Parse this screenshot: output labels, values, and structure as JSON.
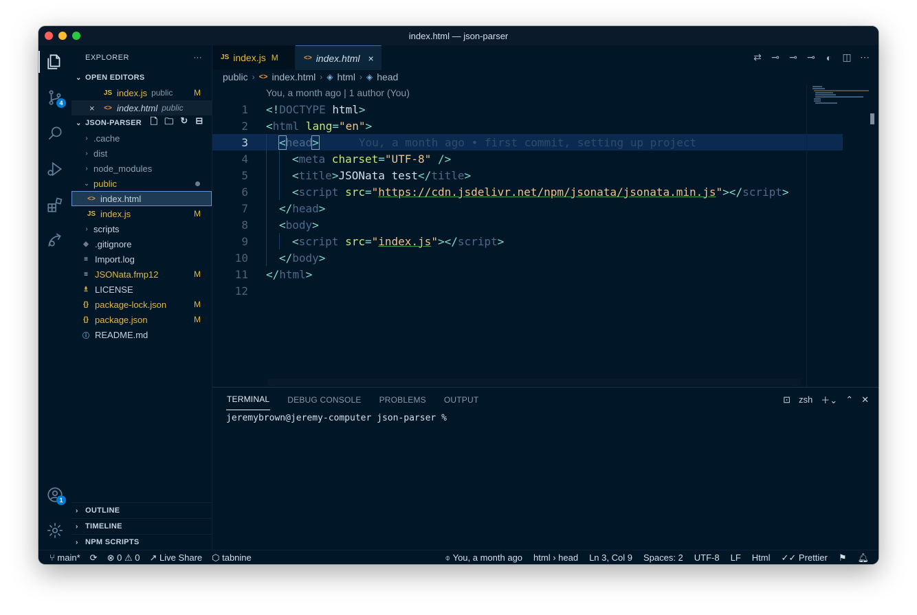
{
  "window": {
    "title": "index.html — json-parser"
  },
  "activity_bar": {
    "items": [
      {
        "icon": "files-icon",
        "active": true
      },
      {
        "icon": "source-control-icon",
        "badge": "4"
      },
      {
        "icon": "search-icon"
      },
      {
        "icon": "run-debug-icon"
      },
      {
        "icon": "extensions-icon"
      },
      {
        "icon": "remote-explorer-icon"
      }
    ],
    "bottom": [
      {
        "icon": "account-icon",
        "badge": "1"
      },
      {
        "icon": "settings-gear-icon"
      }
    ]
  },
  "sidebar": {
    "title": "EXPLORER",
    "more": "···",
    "open_editors": {
      "title": "OPEN EDITORS",
      "items": [
        {
          "icon_text": "JS",
          "name": "index.js",
          "desc": "public",
          "status": "M"
        },
        {
          "icon_text": "<>",
          "name": "index.html",
          "desc": "public",
          "close": "×"
        }
      ]
    },
    "project": {
      "title": "JSON-PARSER",
      "items": [
        {
          "type": "folder",
          "name": ".cache",
          "chev": "›"
        },
        {
          "type": "folder",
          "name": "dist",
          "chev": "›"
        },
        {
          "type": "folder",
          "name": "node_modules",
          "chev": "›"
        },
        {
          "type": "folder-open",
          "name": "public",
          "chev": "⌄"
        },
        {
          "type": "file",
          "icon_text": "<>",
          "name": "index.html",
          "selected": true
        },
        {
          "type": "file",
          "icon_text": "JS",
          "name": "index.js",
          "status": "M"
        },
        {
          "type": "folder",
          "name": "scripts",
          "chev": "›"
        },
        {
          "type": "file",
          "icon_text": "◆",
          "name": ".gitignore"
        },
        {
          "type": "file",
          "icon_text": "≡",
          "name": "Import.log"
        },
        {
          "type": "file",
          "icon_text": "≡",
          "name": "JSONata.fmp12",
          "status": "M"
        },
        {
          "type": "file",
          "icon_text": "♗",
          "name": "LICENSE"
        },
        {
          "type": "file",
          "icon_text": "{}",
          "name": "package-lock.json",
          "status": "M"
        },
        {
          "type": "file",
          "icon_text": "{}",
          "name": "package.json",
          "status": "M"
        },
        {
          "type": "file",
          "icon_text": "ⓘ",
          "name": "README.md"
        }
      ]
    },
    "bottom_sections": [
      "OUTLINE",
      "TIMELINE",
      "NPM SCRIPTS"
    ]
  },
  "tabs": [
    {
      "icon_text": "JS",
      "label": "index.js",
      "status": "M"
    },
    {
      "icon_text": "<>",
      "label": "index.html",
      "close": "×"
    }
  ],
  "breadcrumb": [
    "public",
    "index.html",
    "html",
    "head"
  ],
  "editor": {
    "blame_header": "You, a month ago | 1 author (You)",
    "current_line_blame": "You, a month ago • first commit, setting up project",
    "line_numbers": [
      "1",
      "2",
      "3",
      "4",
      "5",
      "6",
      "7",
      "8",
      "9",
      "10",
      "11",
      "12"
    ]
  },
  "panel": {
    "tabs": [
      "TERMINAL",
      "DEBUG CONSOLE",
      "PROBLEMS",
      "OUTPUT"
    ],
    "shell": "zsh",
    "prompt": "jeremybrown@jeremy-computer json-parser %"
  },
  "statusbar": {
    "branch": "main*",
    "errors": "0",
    "warnings": "0",
    "live_share": "Live Share",
    "tabnine": "tabnine",
    "blame": "You, a month ago",
    "context": "html › head",
    "position": "Ln 3, Col 9",
    "spaces": "Spaces: 2",
    "encoding": "UTF-8",
    "eol": "LF",
    "language": "Html",
    "formatter": "Prettier"
  },
  "colors": {
    "background": "#011627",
    "accent": "#007acc",
    "modified": "#e2b93d",
    "attribute": "#c5e478",
    "string": "#ecc48d",
    "tag": "#4e6a8a"
  }
}
